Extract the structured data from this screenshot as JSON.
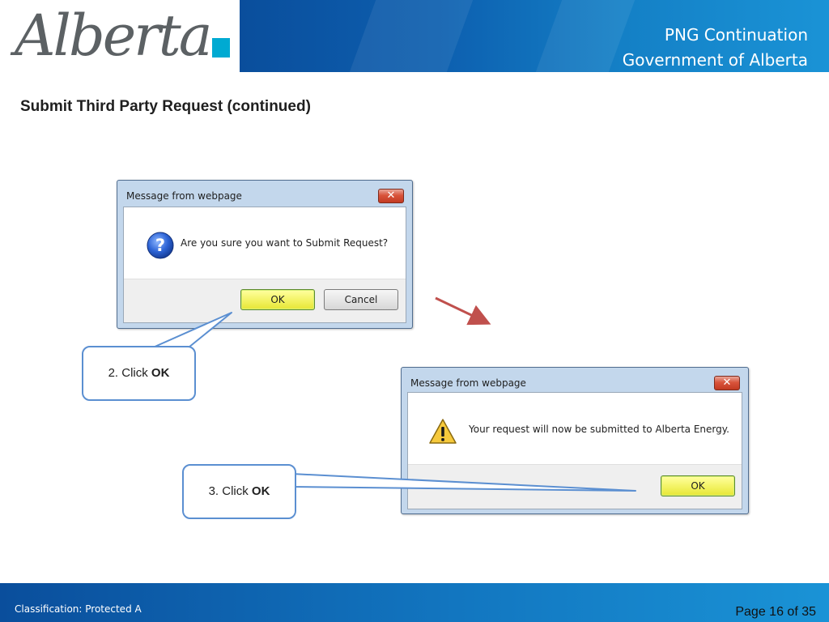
{
  "header": {
    "logo_text": "Alberta",
    "line1": "PNG Continuation",
    "line2": "Government of Alberta"
  },
  "slide": {
    "title": "Submit Third Party Request (continued)"
  },
  "dialog1": {
    "title": "Message from webpage",
    "close_glyph": "✕",
    "icon": "question-icon",
    "message": "Are you sure you want to Submit Request?",
    "ok_label": "OK",
    "cancel_label": "Cancel"
  },
  "dialog2": {
    "title": "Message from webpage",
    "close_glyph": "✕",
    "icon": "warning-icon",
    "message": "Your request will now be submitted to Alberta Energy.",
    "ok_label": "OK"
  },
  "callout1": {
    "prefix": "2. Click ",
    "emphasis": "OK"
  },
  "callout2": {
    "prefix": "3. Click ",
    "emphasis": "OK"
  },
  "footer": {
    "classification": "Classification: Protected A",
    "page": "Page 16 of 35"
  },
  "colors": {
    "banner": "#0d60b0",
    "accent_square": "#00aad2",
    "arrow": "#c0504d",
    "callout_border": "#5b8fd1"
  }
}
